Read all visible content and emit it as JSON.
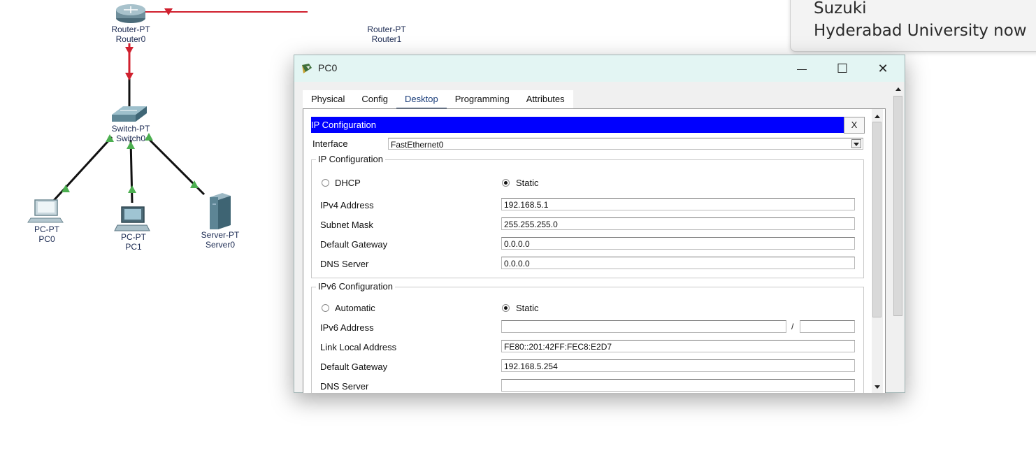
{
  "topology": {
    "devices": [
      {
        "id": "router0",
        "type": "Router-PT",
        "name": "Router0"
      },
      {
        "id": "router1",
        "type": "Router-PT",
        "name": "Router1"
      },
      {
        "id": "switch0",
        "type": "Switch-PT",
        "name": "Switch0"
      },
      {
        "id": "pc0",
        "type": "PC-PT",
        "name": "PC0"
      },
      {
        "id": "pc1",
        "type": "PC-PT",
        "name": "PC1"
      },
      {
        "id": "server0",
        "type": "Server-PT",
        "name": "Server0"
      }
    ],
    "colors": {
      "link_down": "#d0202e",
      "link_up": "#111111",
      "port_up": "#4caf50"
    }
  },
  "notification": {
    "line1": "Suzuki",
    "line2": "Hyderabad University now"
  },
  "window": {
    "title": "PC0",
    "minimize": "—",
    "maximize": "☐",
    "close": "✕",
    "tabs": [
      "Physical",
      "Config",
      "Desktop",
      "Programming",
      "Attributes"
    ],
    "active_tab": "Desktop"
  },
  "ip_config": {
    "header": "IP Configuration",
    "close_label": "X",
    "interface_label": "Interface",
    "interface_value": "FastEthernet0",
    "ipv4": {
      "legend": "IP Configuration",
      "dhcp_label": "DHCP",
      "static_label": "Static",
      "mode": "Static",
      "address_label": "IPv4 Address",
      "address_value": "192.168.5.1",
      "mask_label": "Subnet Mask",
      "mask_value": "255.255.255.0",
      "gateway_label": "Default Gateway",
      "gateway_value": "0.0.0.0",
      "dns_label": "DNS Server",
      "dns_value": "0.0.0.0"
    },
    "ipv6": {
      "legend": "IPv6 Configuration",
      "auto_label": "Automatic",
      "static_label": "Static",
      "mode": "Static",
      "address_label": "IPv6 Address",
      "address_value": "",
      "prefix_separator": "/",
      "prefix_value": "",
      "link_local_label": "Link Local Address",
      "link_local_value": "FE80::201:42FF:FEC8:E2D7",
      "gateway_label": "Default Gateway",
      "gateway_value": "192.168.5.254",
      "dns_label": "DNS Server",
      "dns_value": ""
    }
  }
}
